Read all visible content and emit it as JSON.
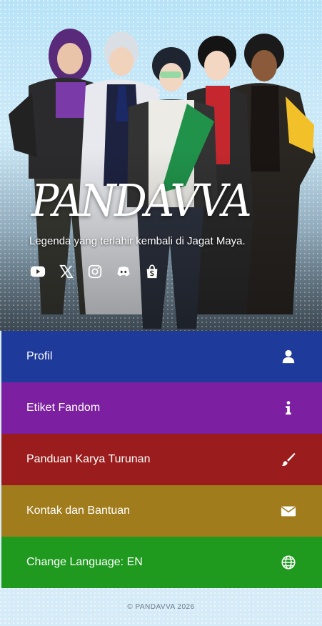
{
  "hero": {
    "brand": "PANDAVVA",
    "tagline": "Legenda yang terlahir kembali di Jagat Maya.",
    "socials": [
      {
        "icon": "youtube-icon"
      },
      {
        "icon": "x-twitter-icon"
      },
      {
        "icon": "instagram-icon"
      },
      {
        "icon": "discord-icon"
      },
      {
        "icon": "shopee-icon"
      }
    ]
  },
  "menu": [
    {
      "label": "Profil",
      "icon": "user-icon",
      "color": "#1e3a9b"
    },
    {
      "label": "Etiket Fandom",
      "icon": "info-icon",
      "color": "#7c1fa0"
    },
    {
      "label": "Panduan Karya Turunan",
      "icon": "paintbrush-icon",
      "color": "#9b1c1c"
    },
    {
      "label": "Kontak dan Bantuan",
      "icon": "envelope-icon",
      "color": "#a07c1c"
    },
    {
      "label": "Change Language: EN",
      "icon": "globe-icon",
      "color": "#1f9a1f"
    }
  ],
  "footer": {
    "copyright": "© PANDAVVA 2026"
  }
}
